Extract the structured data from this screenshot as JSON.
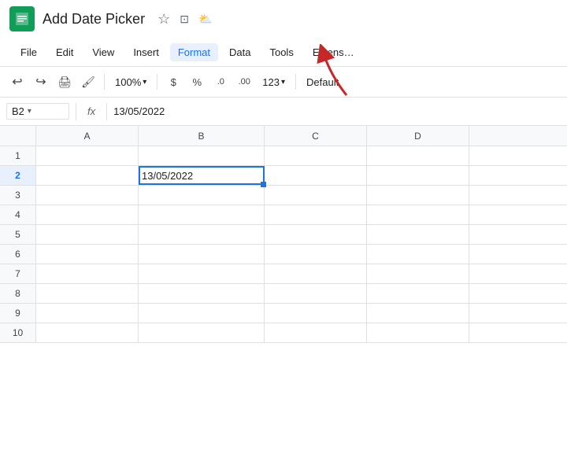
{
  "titleBar": {
    "appName": "Add Date Picker",
    "icons": {
      "star": "☆",
      "folder": "⊡",
      "cloud": "☁"
    }
  },
  "menuBar": {
    "items": [
      {
        "id": "file",
        "label": "File",
        "active": false
      },
      {
        "id": "edit",
        "label": "Edit",
        "active": false
      },
      {
        "id": "view",
        "label": "View",
        "active": false
      },
      {
        "id": "insert",
        "label": "Insert",
        "active": false
      },
      {
        "id": "format",
        "label": "Format",
        "active": true
      },
      {
        "id": "data",
        "label": "Data",
        "active": false
      },
      {
        "id": "tools",
        "label": "Tools",
        "active": false
      },
      {
        "id": "extensions",
        "label": "Extens…",
        "active": false
      }
    ]
  },
  "toolbar": {
    "undoLabel": "↩",
    "redoLabel": "↪",
    "printLabel": "🖨",
    "paintLabel": "🖌",
    "zoomValue": "100%",
    "zoomArrow": "▾",
    "currencyLabel": "$",
    "percentLabel": "%",
    "decimalDecLabel": ".0",
    "decimalIncLabel": ".00",
    "formatTypeLabel": "123",
    "formatArrow": "▾",
    "defaultStyleLabel": "Default"
  },
  "formulaBar": {
    "cellRef": "B2",
    "fxLabel": "fx",
    "formula": "13/05/2022"
  },
  "columns": [
    "A",
    "B",
    "C",
    "D"
  ],
  "rows": [
    {
      "num": "1",
      "cells": [
        "",
        "",
        "",
        ""
      ]
    },
    {
      "num": "2",
      "cells": [
        "",
        "13/05/2022",
        "",
        ""
      ],
      "activeCol": 1
    },
    {
      "num": "3",
      "cells": [
        "",
        "",
        "",
        ""
      ]
    },
    {
      "num": "4",
      "cells": [
        "",
        "",
        "",
        ""
      ]
    },
    {
      "num": "5",
      "cells": [
        "",
        "",
        "",
        ""
      ]
    },
    {
      "num": "6",
      "cells": [
        "",
        "",
        "",
        ""
      ]
    },
    {
      "num": "7",
      "cells": [
        "",
        "",
        "",
        ""
      ]
    },
    {
      "num": "8",
      "cells": [
        "",
        "",
        "",
        ""
      ]
    },
    {
      "num": "9",
      "cells": [
        "",
        "",
        "",
        ""
      ]
    },
    {
      "num": "10",
      "cells": [
        "",
        "",
        "",
        ""
      ]
    }
  ]
}
